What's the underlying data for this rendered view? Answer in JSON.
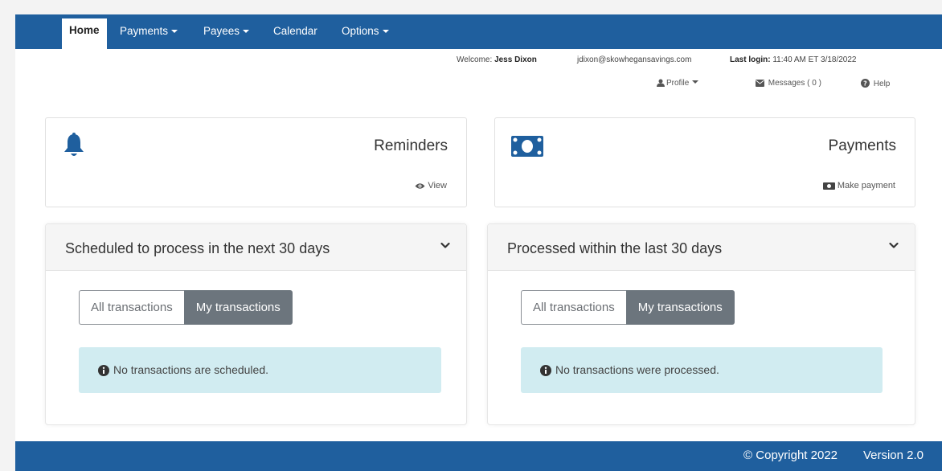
{
  "nav": {
    "items": [
      {
        "label": "Home",
        "dropdown": false,
        "active": true
      },
      {
        "label": "Payments",
        "dropdown": true,
        "active": false
      },
      {
        "label": "Payees",
        "dropdown": true,
        "active": false
      },
      {
        "label": "Calendar",
        "dropdown": false,
        "active": false
      },
      {
        "label": "Options",
        "dropdown": true,
        "active": false
      }
    ]
  },
  "user": {
    "welcome_label": "Welcome:",
    "name": "Jess Dixon",
    "email": "jdixon@skowhegansavings.com",
    "last_login_label": "Last login:",
    "last_login": "11:40 AM ET 3/18/2022",
    "profile_label": "Profile",
    "messages_label": "Messages ( 0 )",
    "help_label": "Help"
  },
  "cards": {
    "reminders": {
      "title": "Reminders",
      "link": "View",
      "icon": "bell-icon"
    },
    "payments": {
      "title": "Payments",
      "link": "Make payment",
      "icon": "money-bill-icon"
    }
  },
  "panels": {
    "scheduled": {
      "title": "Scheduled to process in the next 30 days",
      "toggle_all": "All transactions",
      "toggle_mine": "My transactions",
      "message": "No transactions are scheduled."
    },
    "processed": {
      "title": "Processed within the last 30 days",
      "toggle_all": "All transactions",
      "toggle_mine": "My transactions",
      "message": "No transactions were processed."
    }
  },
  "footer": {
    "copyright": "© Copyright  2022",
    "version": "Version 2.0"
  },
  "colors": {
    "brand": "#1f5f9e",
    "alert_bg": "#d1ecf1",
    "toggle_active": "#6c757d"
  }
}
